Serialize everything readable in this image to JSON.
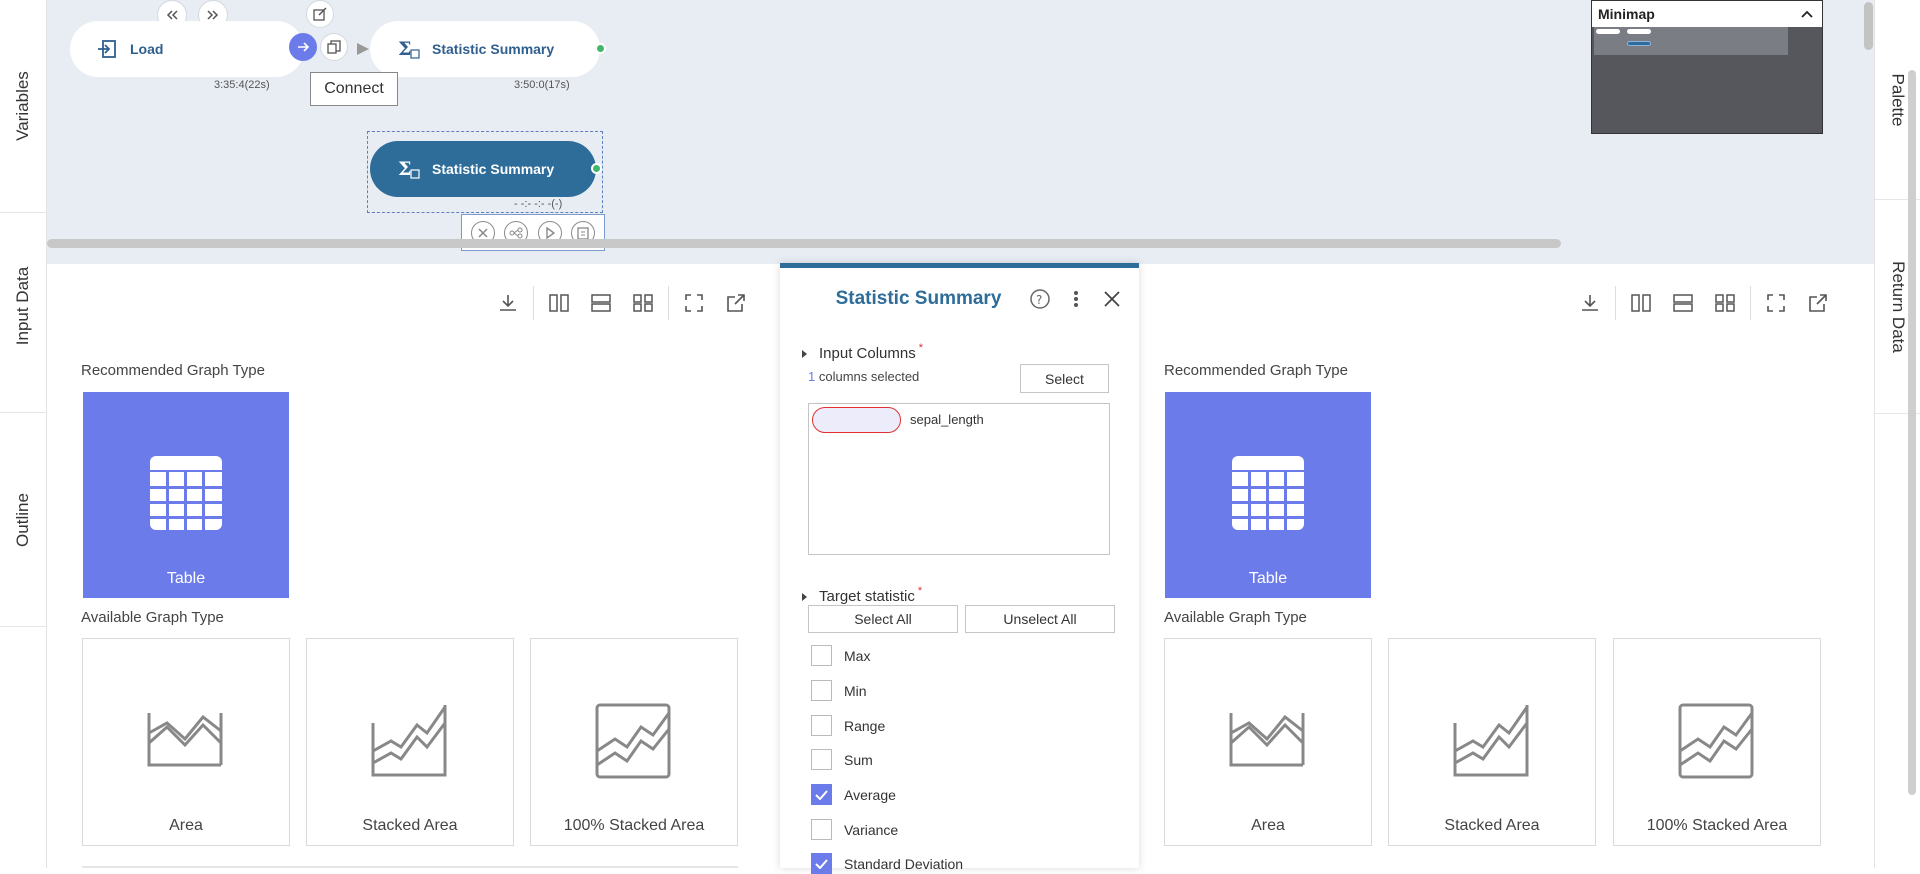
{
  "side_left": {
    "tabs": [
      "Variables",
      "Input Data",
      "Outline"
    ]
  },
  "side_right": {
    "tabs": [
      "Palette",
      "Return Data"
    ]
  },
  "canvas": {
    "nodes": [
      {
        "label": "Load",
        "time": "3:35:4(22s)"
      },
      {
        "label": "Statistic Summary",
        "time": "3:50:0(17s)"
      },
      {
        "label": "Statistic Summary",
        "time": "- -:- -:- -(-)"
      }
    ],
    "connect_tooltip": "Connect",
    "minimap_title": "Minimap"
  },
  "left_viz": {
    "recommended_heading": "Recommended Graph Type",
    "recommended_card": "Table",
    "available_heading": "Available Graph Type",
    "available_cards": [
      "Area",
      "Stacked Area",
      "100% Stacked Area"
    ]
  },
  "right_viz": {
    "recommended_heading": "Recommended Graph Type",
    "recommended_card": "Table",
    "available_heading": "Available Graph Type",
    "available_cards": [
      "Area",
      "Stacked Area",
      "100% Stacked Area"
    ]
  },
  "panel": {
    "title": "Statistic Summary",
    "input_columns_label": "Input Columns",
    "required_mark": "*",
    "selected_count": "1",
    "selected_suffix": " columns selected",
    "select_button": "Select",
    "column_chip": "sepal_length",
    "target_statistic_label": "Target statistic",
    "select_all_button": "Select All",
    "unselect_all_button": "Unselect All",
    "statistics": [
      {
        "label": "Max",
        "checked": false
      },
      {
        "label": "Min",
        "checked": false
      },
      {
        "label": "Range",
        "checked": false
      },
      {
        "label": "Sum",
        "checked": false
      },
      {
        "label": "Average",
        "checked": true
      },
      {
        "label": "Variance",
        "checked": false
      },
      {
        "label": "Standard Deviation",
        "checked": true
      }
    ]
  },
  "colors": {
    "accent": "#6b7bea",
    "node_selected": "#2e6c99",
    "status_green": "#3fb86a",
    "canvas_bg": "#e8ecf3"
  }
}
